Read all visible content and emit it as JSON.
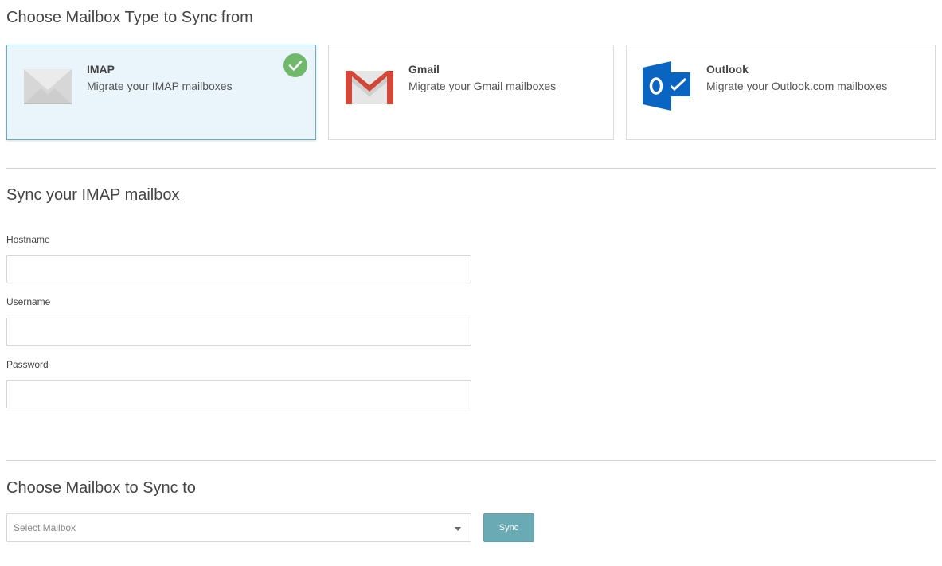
{
  "source": {
    "title": "Choose Mailbox Type to Sync from",
    "cards": [
      {
        "title": "IMAP",
        "description": "Migrate your IMAP mailboxes",
        "selected": true,
        "icon": "envelope-icon"
      },
      {
        "title": "Gmail",
        "description": "Migrate your Gmail mailboxes",
        "selected": false,
        "icon": "gmail-logo-icon"
      },
      {
        "title": "Outlook",
        "description": "Migrate your Outlook.com mailboxes",
        "selected": false,
        "icon": "outlook-logo-icon"
      }
    ]
  },
  "imap_form": {
    "title": "Sync your IMAP mailbox",
    "hostname_label": "Hostname",
    "hostname_value": "",
    "username_label": "Username",
    "username_value": "",
    "password_label": "Password",
    "password_value": ""
  },
  "destination": {
    "title": "Choose Mailbox to Sync to",
    "select_placeholder": "Select Mailbox",
    "sync_label": "Sync"
  },
  "colors": {
    "selected_card_bg": "#eaf5fb",
    "selected_card_border": "#64b0c8",
    "check_green": "#71b96a",
    "sync_button": "#6aaab5",
    "gmail_red": "#d44638",
    "outlook_blue": "#0a64c2"
  }
}
